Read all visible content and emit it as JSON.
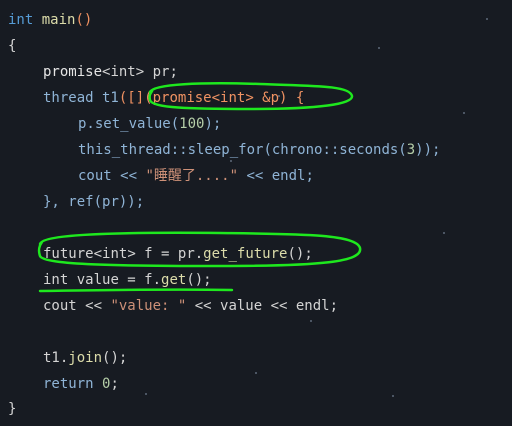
{
  "code": {
    "l1": {
      "kw": "int",
      "fn": "main",
      "paren": "()"
    },
    "l2": "{",
    "l3": {
      "t1": "promise",
      "t2": "<",
      "t3": "int",
      "t4": "> pr;"
    },
    "l4": {
      "kw": "thread",
      "t1": " t1",
      "t2": "([]",
      "t3": "(promise<int> &p)",
      "t4": " {"
    },
    "l5": {
      "t1": "p.",
      "t2": "set_value",
      "t3": "(",
      "t4": "100",
      "t5": ");"
    },
    "l6": {
      "t1": "this_thread::",
      "t2": "sleep_for",
      "t3": "(",
      "t4": "chrono::seconds(",
      "t5": "3",
      "t6": "));"
    },
    "l7": {
      "t1": "cout << ",
      "t2": "\"睡醒了....\"",
      "t3": " << endl;"
    },
    "l8": {
      "t1": "}, ",
      "t2": "ref",
      "t3": "(pr));"
    },
    "l9": {
      "t1": "future<",
      "t2": "int",
      "t3": "> f = pr.",
      "t4": "get_future",
      "t5": "();"
    },
    "l10": {
      "kw": "int",
      "t1": " value = f.",
      "t2": "get",
      "t3": "();"
    },
    "l11": {
      "t1": "cout << ",
      "t2": "\"value: \"",
      "t3": " << value << endl;"
    },
    "l12": {
      "t1": "t1.",
      "t2": "join",
      "t3": "();"
    },
    "l13": {
      "kw": "return",
      "t1": " ",
      "t2": "0",
      "t3": ";"
    },
    "l14": "}"
  },
  "colors": {
    "background": "#171b22",
    "annotation": "#1ee81e"
  }
}
